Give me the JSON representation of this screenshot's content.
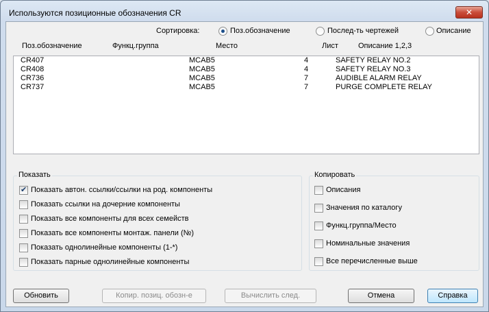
{
  "window": {
    "title": "Используются позиционные обозначения CR",
    "close_glyph": "✕"
  },
  "sort": {
    "label": "Сортировка:",
    "options": [
      {
        "label": "Поз.обозначение",
        "checked": true
      },
      {
        "label": "Послед-ть чертежей",
        "checked": false
      },
      {
        "label": "Описание",
        "checked": false
      }
    ]
  },
  "columns": [
    "Поз.обозначение",
    "Функц.группа",
    "Место",
    "Лист",
    "Описание 1,2,3"
  ],
  "rows": [
    {
      "tag": "CR407",
      "group": "",
      "loc": "MCAB5",
      "sheet": "4",
      "desc": "SAFETY RELAY NO.2"
    },
    {
      "tag": "CR408",
      "group": "",
      "loc": "MCAB5",
      "sheet": "4",
      "desc": "SAFETY RELAY NO.3"
    },
    {
      "tag": "CR736",
      "group": "",
      "loc": "MCAB5",
      "sheet": "7",
      "desc": "AUDIBLE ALARM RELAY"
    },
    {
      "tag": "CR737",
      "group": "",
      "loc": "MCAB5",
      "sheet": "7",
      "desc": "PURGE COMPLETE RELAY"
    }
  ],
  "show": {
    "title": "Показать",
    "items": [
      {
        "label": "Показать автон. ссылки/ссылки на род. компоненты",
        "checked": true
      },
      {
        "label": "Показать ссылки на дочерние компоненты",
        "checked": false
      },
      {
        "label": "Показать все компоненты для всех семейств",
        "checked": false
      },
      {
        "label": "Показать все компоненты монтаж. панели (№)",
        "checked": false
      },
      {
        "label": "Показать однолинейные компоненты (1-*)",
        "checked": false
      },
      {
        "label": "Показать парные однолинейные компоненты",
        "checked": false
      }
    ]
  },
  "copy": {
    "title": "Копировать",
    "items": [
      {
        "label": "Описания",
        "checked": false
      },
      {
        "label": "Значения по каталогу",
        "checked": false
      },
      {
        "label": "Функц.группа/Место",
        "checked": false
      },
      {
        "label": "Номинальные значения",
        "checked": false
      },
      {
        "label": "Все перечисленные выше",
        "checked": false
      }
    ]
  },
  "buttons": {
    "refresh": "Обновить",
    "copy_tag": "Копир. позиц. обозн-е",
    "calc_next": "Вычислить след.",
    "cancel": "Отмена",
    "help": "Справка"
  },
  "checkmark_glyph": "✔"
}
